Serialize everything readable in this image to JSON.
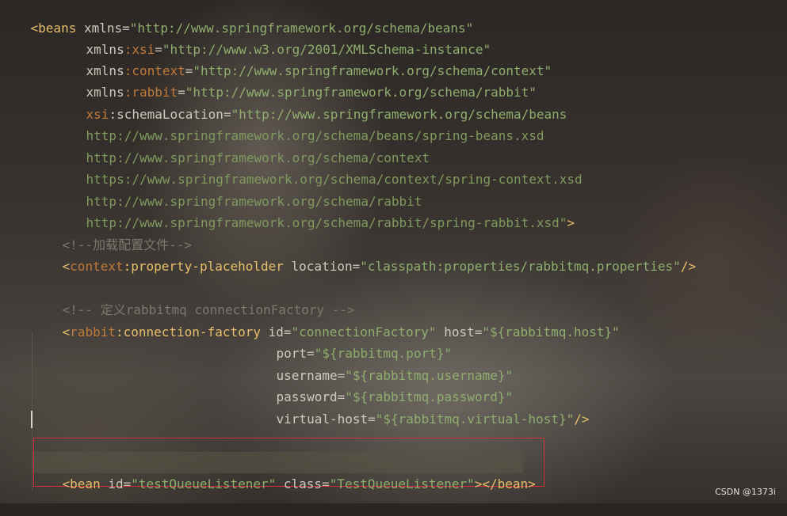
{
  "code": {
    "l1": {
      "t1": "<beans ",
      "a1": "xmlns",
      "e1": "=",
      "v1": "\"http://www.springframework.org/schema/beans\""
    },
    "l2": {
      "a1": "xmlns",
      "ns": ":xsi",
      "e1": "=",
      "v1": "\"http://www.w3.org/2001/XMLSchema-instance\""
    },
    "l3": {
      "a1": "xmlns",
      "ns": ":context",
      "e1": "=",
      "v1": "\"http://www.springframework.org/schema/context\""
    },
    "l4": {
      "a1": "xmlns",
      "ns": ":rabbit",
      "e1": "=",
      "v1": "\"http://www.springframework.org/schema/rabbit\""
    },
    "l5": {
      "ns": "xsi",
      "a1": ":schemaLocation",
      "e1": "=",
      "v1": "\"http://www.springframework.org/schema/beans"
    },
    "l6": {
      "v1": "http://www.springframework.org/schema/beans/spring-beans.xsd"
    },
    "l7": {
      "v1": "http://www.springframework.org/schema/context"
    },
    "l8": {
      "v1": "https://www.springframework.org/schema/context/spring-context.xsd"
    },
    "l9": {
      "v1": "http://www.springframework.org/schema/rabbit"
    },
    "l10": {
      "v1": "http://www.springframework.org/schema/rabbit/spring-rabbit.xsd\"",
      "t1": ">"
    },
    "l11": {
      "c1": "<!--加载配置文件-->"
    },
    "l12": {
      "t1": "<",
      "ns": "context",
      "t2": ":property-placeholder ",
      "a1": "location",
      "e1": "=",
      "v1": "\"classpath:properties/rabbitmq.properties\"",
      "t3": "/>"
    },
    "l13": {
      "c1": "<!-- 定义rabbitmq connectionFactory -->"
    },
    "l14": {
      "t1": "<",
      "ns": "rabbit",
      "t2": ":connection-factory ",
      "a1": "id",
      "e1": "=",
      "v1": "\"connectionFactory\"",
      "a2": " host",
      "e2": "=",
      "v2": "\"${rabbitmq.host}\""
    },
    "l15": {
      "a1": "port",
      "e1": "=",
      "v1": "\"${rabbitmq.port}\""
    },
    "l16": {
      "a1": "username",
      "e1": "=",
      "v1": "\"${rabbitmq.username}\""
    },
    "l17": {
      "a1": "password",
      "e1": "=",
      "v1": "\"${rabbitmq.password}\""
    },
    "l18": {
      "a1": "virtual-host",
      "e1": "=",
      "v1": "\"${rabbitmq.virtual-host}\"",
      "t1": "/>"
    },
    "l19": {
      "t1": "<bean ",
      "a1": "id",
      "e1": "=",
      "v1": "\"testQueueListener\"",
      "a2": " class",
      "e2": "=",
      "v2": "\"TestQueueListener\"",
      "t2": "></bean>"
    }
  },
  "watermark": "CSDN @1373i"
}
